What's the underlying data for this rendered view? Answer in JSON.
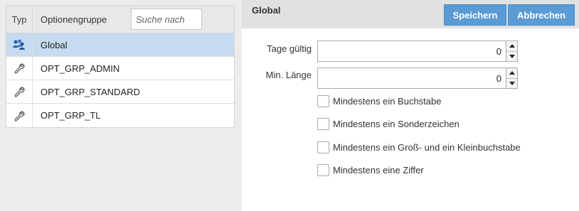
{
  "group_list": {
    "header": {
      "typ_label": "Typ",
      "name_label": "Optionengruppe",
      "search_placeholder": "Suche nach"
    },
    "rows": [
      {
        "label": "Global",
        "icon": "users-group-icon",
        "selected": true
      },
      {
        "label": "OPT_GRP_ADMIN",
        "icon": "wrench-icon",
        "selected": false
      },
      {
        "label": "OPT_GRP_STANDARD",
        "icon": "wrench-icon",
        "selected": false
      },
      {
        "label": "OPT_GRP_TL",
        "icon": "wrench-icon",
        "selected": false
      }
    ]
  },
  "detail": {
    "title": "Global",
    "save_label": "Speichern",
    "cancel_label": "Abbrechen",
    "fields": [
      {
        "label": "Tage gültig",
        "value": "0"
      },
      {
        "label": "Min. Länge",
        "value": "0"
      }
    ],
    "checkboxes": [
      {
        "label": "Mindestens ein Buchstabe",
        "checked": false
      },
      {
        "label": "Mindestens ein Sonderzeichen",
        "checked": false
      },
      {
        "label": "Mindestens ein Groß- und ein Kleinbuchstabe",
        "checked": false
      },
      {
        "label": "Mindestens eine Ziffer",
        "checked": false
      }
    ]
  },
  "colors": {
    "accent": "#5b9bd5",
    "selected_row": "#c5dcf0",
    "panel_bg": "#ececec",
    "header_bg": "#e1e1e1"
  }
}
